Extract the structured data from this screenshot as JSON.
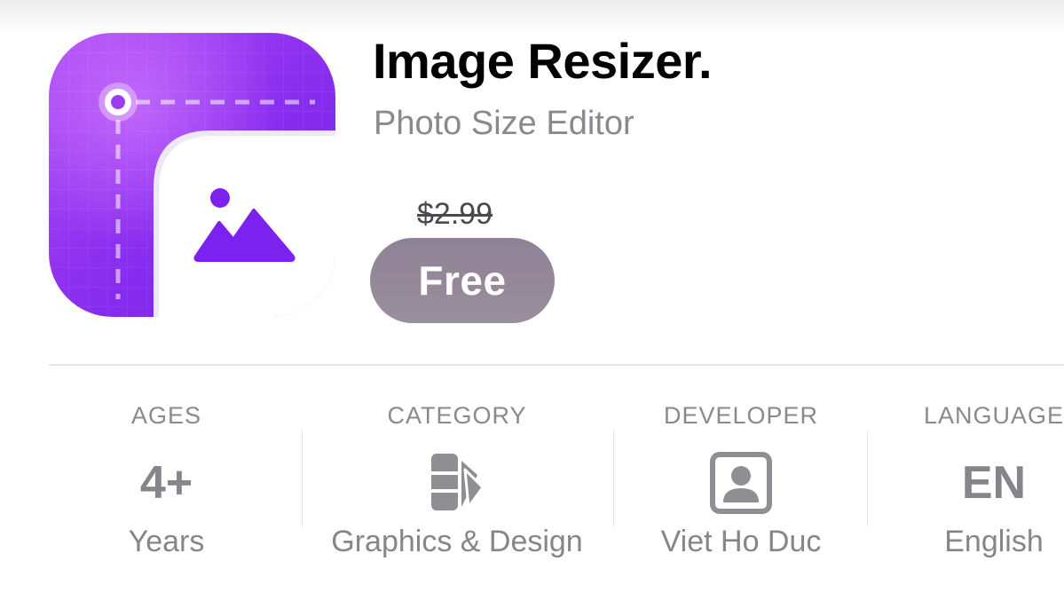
{
  "app": {
    "title": "Image Resizer.",
    "subtitle": "Photo Size Editor",
    "original_price": "$2.99",
    "get_label": "Free",
    "icon_name": "image-resizer-app-icon",
    "accent_color": "#8a2be2"
  },
  "info": {
    "ages": {
      "label": "AGES",
      "value": "4+",
      "sub": "Years"
    },
    "category": {
      "label": "CATEGORY",
      "icon": "graphics-design-icon",
      "sub": "Graphics & Design"
    },
    "developer": {
      "label": "DEVELOPER",
      "icon": "developer-person-icon",
      "sub": "Viet Ho Duc"
    },
    "language": {
      "label": "LANGUAGE",
      "value": "EN",
      "sub": "English"
    }
  }
}
